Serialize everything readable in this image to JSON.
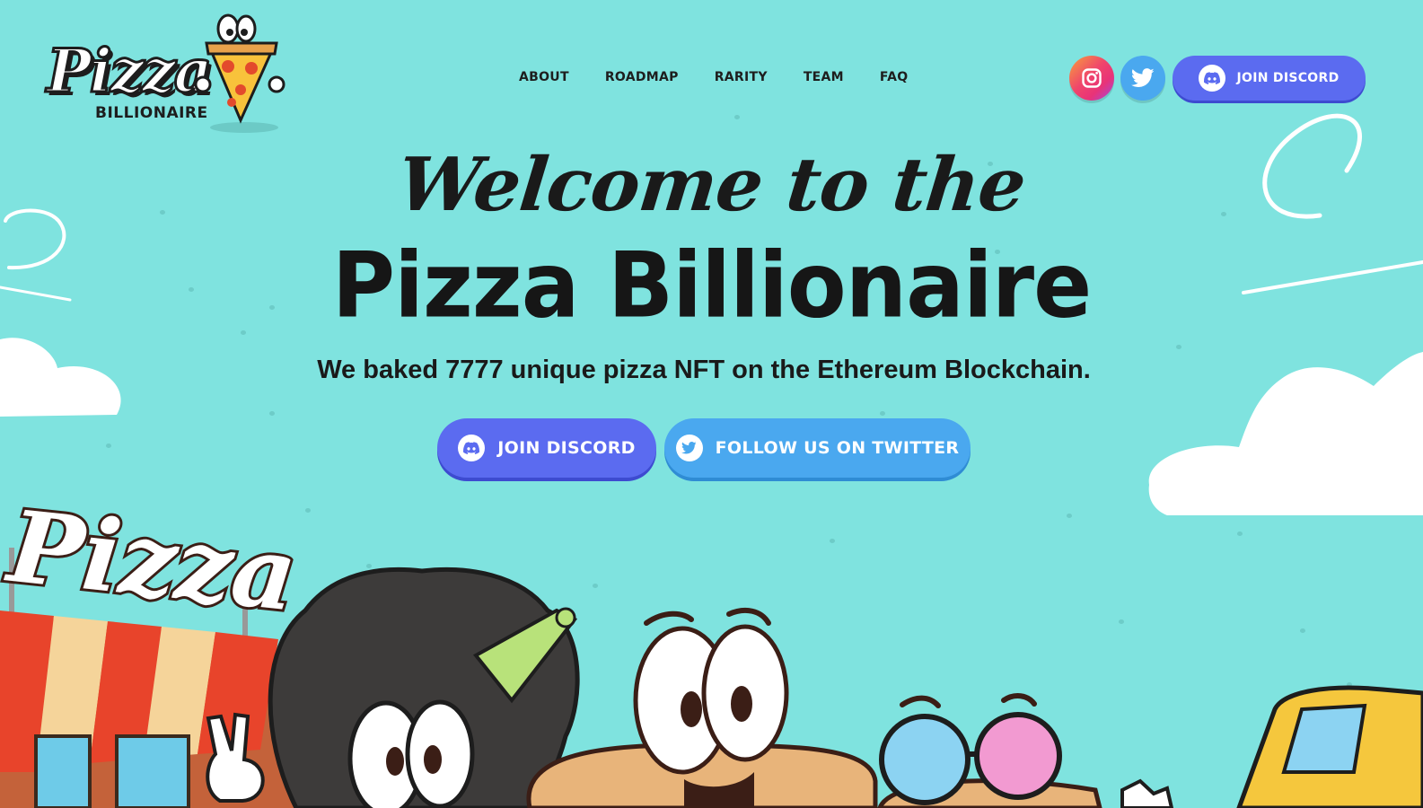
{
  "brand": {
    "logo_word": "Pizza",
    "logo_sub": "BILLIONAIRE"
  },
  "nav": {
    "items": [
      "ABOUT",
      "ROADMAP",
      "RARITY",
      "TEAM",
      "FAQ"
    ]
  },
  "header_actions": {
    "instagram_icon": "instagram-icon",
    "twitter_icon": "twitter-icon",
    "discord_label": "JOIN DISCORD",
    "discord_icon": "discord-icon"
  },
  "hero": {
    "welcome": "Welcome to the",
    "title": "Pizza Billionaire",
    "tagline": "We baked 7777 unique pizza NFT on the Ethereum Blockchain.",
    "cta_discord": "JOIN DISCORD",
    "cta_twitter": "FOLLOW US ON TWITTER"
  },
  "scene": {
    "shop_sign": "Pizza"
  },
  "colors": {
    "background": "#7fe3df",
    "discord": "#5b6bf0",
    "twitter": "#4aa8ef",
    "text": "#1a1a1a"
  }
}
